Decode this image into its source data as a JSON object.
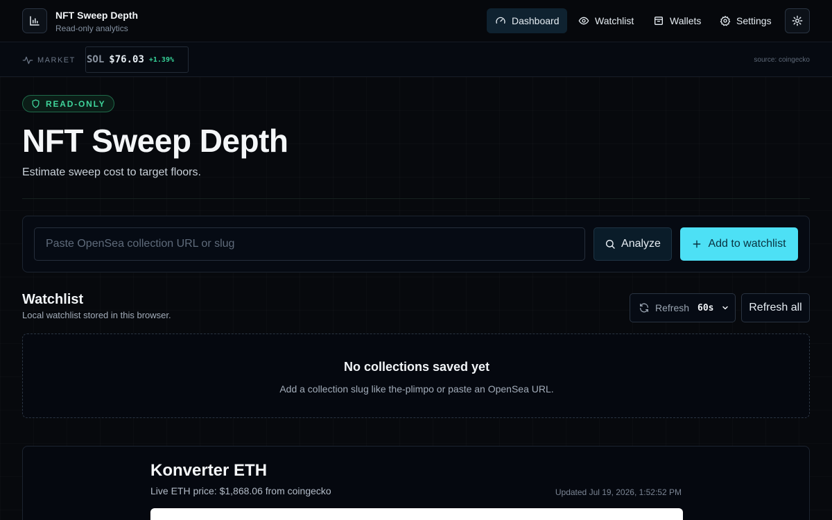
{
  "brand": {
    "title": "NFT Sweep Depth",
    "subtitle": "Read-only analytics",
    "logo_icon": "bar-chart-icon"
  },
  "nav": {
    "items": [
      {
        "label": "Dashboard",
        "icon": "gauge-icon",
        "active": true
      },
      {
        "label": "Watchlist",
        "icon": "eye-icon",
        "active": false
      },
      {
        "label": "Wallets",
        "icon": "wallet-icon",
        "active": false
      },
      {
        "label": "Settings",
        "icon": "gear-icon",
        "active": false
      }
    ],
    "theme_icon": "sun-icon"
  },
  "market": {
    "label": "MARKET",
    "ticker": {
      "symbol": "SOL",
      "price": "$76.03",
      "change": "+1.39%"
    },
    "source": "source: coingecko"
  },
  "hero": {
    "badge": "READ-ONLY",
    "title": "NFT Sweep Depth",
    "subtitle": "Estimate sweep cost to target floors."
  },
  "search": {
    "placeholder": "Paste OpenSea collection URL or slug",
    "value": "",
    "analyze_label": "Analyze",
    "add_label": "Add to watchlist"
  },
  "watchlist": {
    "title": "Watchlist",
    "subtitle": "Local watchlist stored in this browser.",
    "refresh_label": "Refresh",
    "refresh_interval": "60s",
    "refresh_all_label": "Refresh all",
    "empty_title": "No collections saved yet",
    "empty_subtitle": "Add a collection slug like the-plimpo or paste an OpenSea URL."
  },
  "converter": {
    "title": "Konverter ETH",
    "subtitle": "Live ETH price: $1,868.06 from coingecko",
    "updated": "Updated Jul 19, 2026, 1:52:52 PM"
  },
  "colors": {
    "accent": "#4de0f5",
    "positive": "#36d399",
    "badge": "#3fd59b",
    "background": "#07090d"
  }
}
